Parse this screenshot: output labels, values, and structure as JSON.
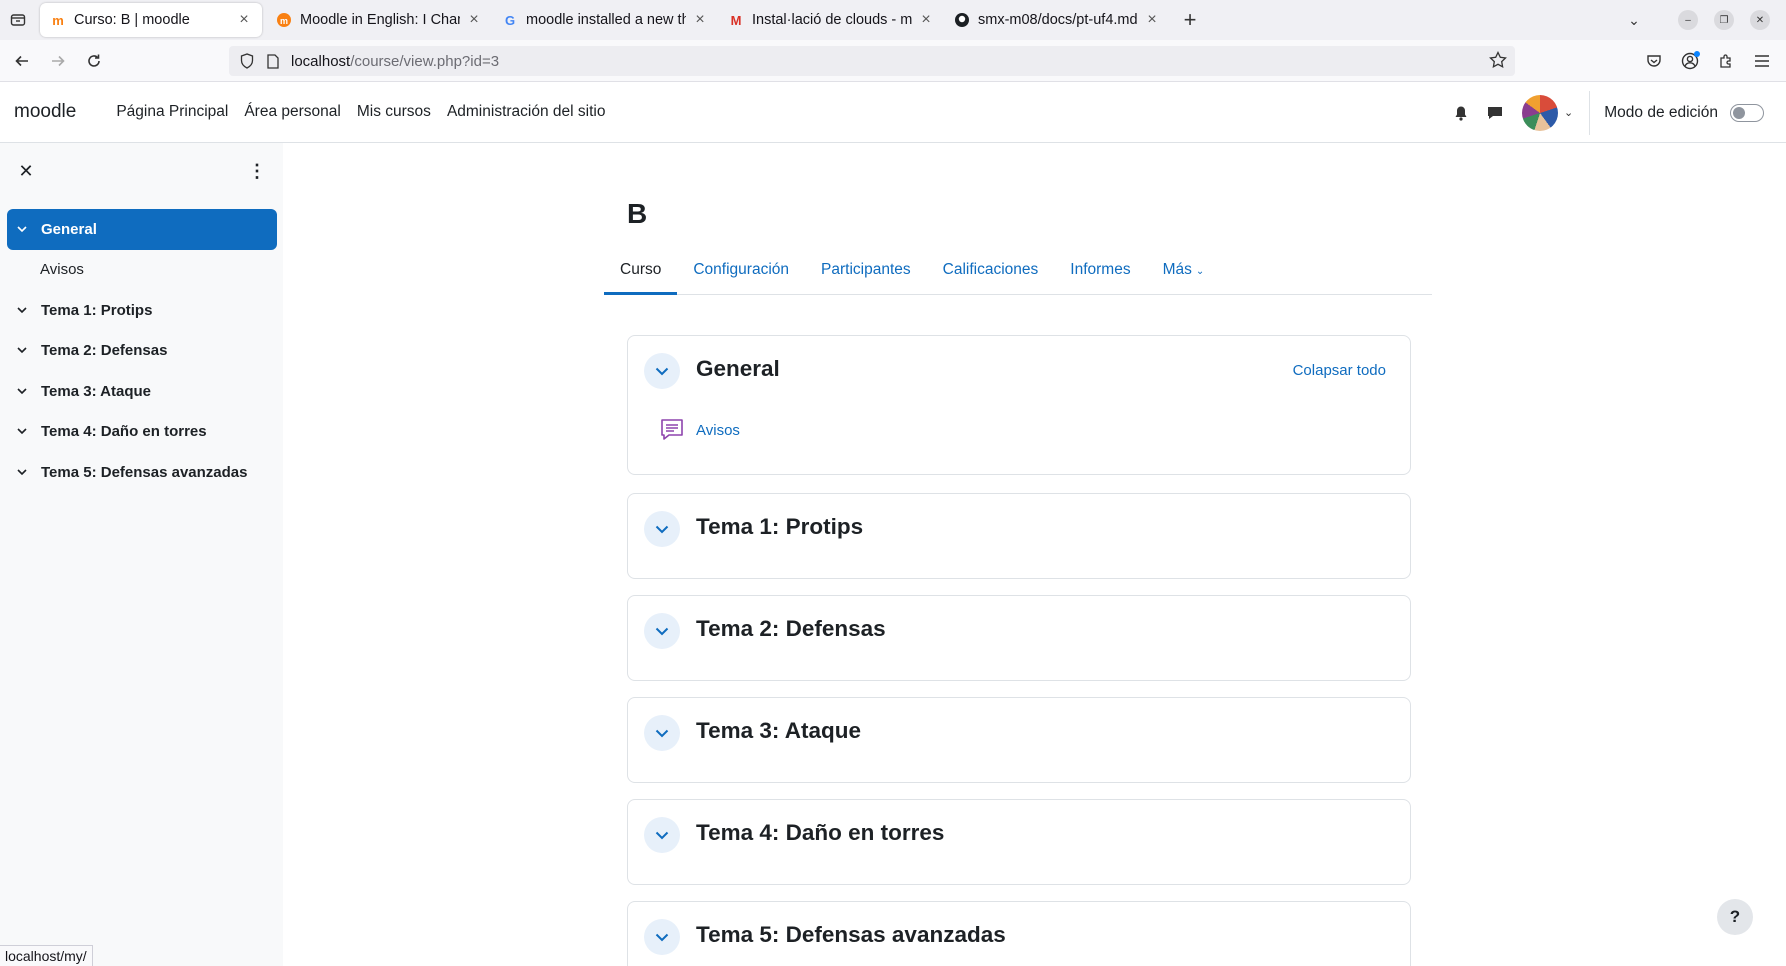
{
  "browser": {
    "tabs": [
      {
        "title": "Curso: B | moodle",
        "icon": "moodle-favicon",
        "active": true
      },
      {
        "title": "Moodle in English: I Chang",
        "icon": "moodle-org-favicon"
      },
      {
        "title": "moodle installed a new th",
        "icon": "google-favicon"
      },
      {
        "title": "Instal·lació de clouds - mr",
        "icon": "gmail-favicon"
      },
      {
        "title": "smx-m08/docs/pt-uf4.md",
        "icon": "github-favicon"
      }
    ],
    "url_host": "localhost",
    "url_path": "/course/view.php?id=3",
    "status_url": "localhost/my/"
  },
  "header": {
    "brand": "moodle",
    "nav": [
      "Página Principal",
      "Área personal",
      "Mis cursos",
      "Administración del sitio"
    ],
    "edit_mode_label": "Modo de edición",
    "edit_mode_on": false
  },
  "course_index": {
    "items": [
      {
        "label": "General",
        "active": true,
        "type": "section"
      },
      {
        "label": "Avisos",
        "type": "activity"
      },
      {
        "label": "Tema 1: Protips",
        "type": "section"
      },
      {
        "label": "Tema 2: Defensas",
        "type": "section"
      },
      {
        "label": "Tema 3: Ataque",
        "type": "section"
      },
      {
        "label": "Tema 4: Daño en torres",
        "type": "section"
      },
      {
        "label": "Tema 5: Defensas avanzadas",
        "type": "section"
      }
    ]
  },
  "course": {
    "title": "B",
    "tabs": [
      "Curso",
      "Configuración",
      "Participantes",
      "Calificaciones",
      "Informes",
      "Más"
    ],
    "active_tab": "Curso",
    "collapse_all": "Colapsar todo",
    "sections": [
      {
        "title": "General",
        "activities": [
          {
            "name": "Avisos",
            "icon": "forum-icon"
          }
        ]
      },
      {
        "title": "Tema 1: Protips"
      },
      {
        "title": "Tema 2: Defensas"
      },
      {
        "title": "Tema 3: Ataque"
      },
      {
        "title": "Tema 4: Daño en torres"
      },
      {
        "title": "Tema 5: Defensas avanzadas"
      }
    ]
  },
  "colors": {
    "primary": "#0f6cbf",
    "text": "#1d2125",
    "drawer_bg": "#f8f9fa"
  }
}
